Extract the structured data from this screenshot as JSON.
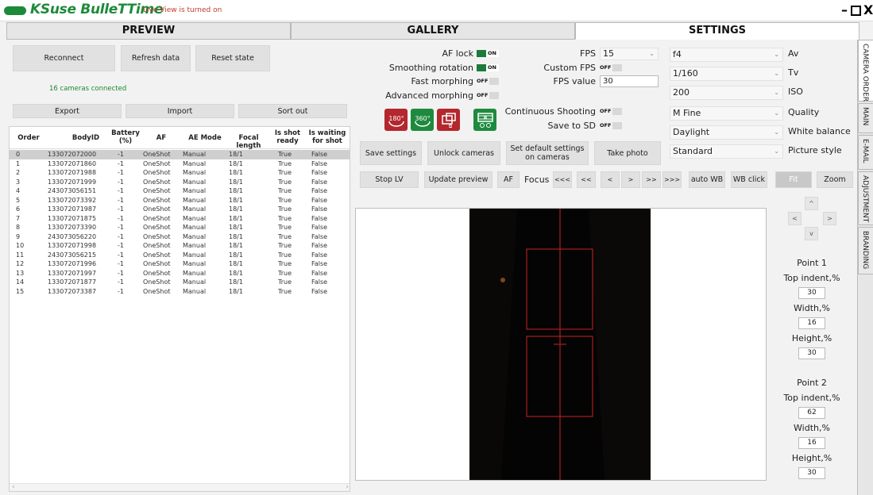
{
  "app": {
    "title": "KSuse BulleTTime",
    "live_view_status": "Live View is turned on"
  },
  "main_tabs": [
    {
      "label": "PREVIEW"
    },
    {
      "label": "GALLERY"
    },
    {
      "label": "SETTINGS"
    }
  ],
  "left_panel": {
    "reconnect": "Reconnect",
    "refresh": "Refresh data",
    "reset": "Reset state",
    "connected": "16 cameras connected",
    "export": "Export",
    "import": "Import",
    "sort": "Sort out"
  },
  "table": {
    "columns": [
      "Order",
      "BodyID",
      "Battery (%)",
      "AF",
      "AE Mode",
      "Focal length",
      "Is shot ready",
      "Is waiting for shot"
    ],
    "rows": [
      [
        "0",
        "133072072000",
        "-1",
        "OneShot",
        "Manual",
        "18/1",
        "True",
        "False"
      ],
      [
        "1",
        "133072071860",
        "-1",
        "OneShot",
        "Manual",
        "18/1",
        "True",
        "False"
      ],
      [
        "2",
        "133072071988",
        "-1",
        "OneShot",
        "Manual",
        "18/1",
        "True",
        "False"
      ],
      [
        "3",
        "133072071999",
        "-1",
        "OneShot",
        "Manual",
        "18/1",
        "True",
        "False"
      ],
      [
        "4",
        "243073056151",
        "-1",
        "OneShot",
        "Manual",
        "18/1",
        "True",
        "False"
      ],
      [
        "5",
        "133072073392",
        "-1",
        "OneShot",
        "Manual",
        "18/1",
        "True",
        "False"
      ],
      [
        "6",
        "133072071987",
        "-1",
        "OneShot",
        "Manual",
        "18/1",
        "True",
        "False"
      ],
      [
        "7",
        "133072071875",
        "-1",
        "OneShot",
        "Manual",
        "18/1",
        "True",
        "False"
      ],
      [
        "8",
        "133072073390",
        "-1",
        "OneShot",
        "Manual",
        "18/1",
        "True",
        "False"
      ],
      [
        "9",
        "243073056220",
        "-1",
        "OneShot",
        "Manual",
        "18/1",
        "True",
        "False"
      ],
      [
        "10",
        "133072071998",
        "-1",
        "OneShot",
        "Manual",
        "18/1",
        "True",
        "False"
      ],
      [
        "11",
        "243073056215",
        "-1",
        "OneShot",
        "Manual",
        "18/1",
        "True",
        "False"
      ],
      [
        "12",
        "133072071996",
        "-1",
        "OneShot",
        "Manual",
        "18/1",
        "True",
        "False"
      ],
      [
        "13",
        "133072071997",
        "-1",
        "OneShot",
        "Manual",
        "18/1",
        "True",
        "False"
      ],
      [
        "14",
        "133072071877",
        "-1",
        "OneShot",
        "Manual",
        "18/1",
        "True",
        "False"
      ],
      [
        "15",
        "133072073387",
        "-1",
        "OneShot",
        "Manual",
        "18/1",
        "True",
        "False"
      ]
    ]
  },
  "toggles": {
    "af_lock": {
      "label": "AF lock",
      "state": "ON"
    },
    "smoothing": {
      "label": "Smoothing rotation",
      "state": "ON"
    },
    "fast_morph": {
      "label": "Fast morphing",
      "state": "OFF"
    },
    "adv_morph": {
      "label": "Advanced morphing",
      "state": "OFF"
    },
    "custom_fps": {
      "label": "Custom FPS",
      "state": "OFF"
    },
    "continuous": {
      "label": "Continuous Shooting",
      "state": "OFF"
    },
    "save_sd": {
      "label": "Save to SD",
      "state": "OFF"
    }
  },
  "fps": {
    "label": "FPS",
    "value": "15",
    "value_label": "FPS value",
    "custom_value": "30"
  },
  "mode_icons": [
    {
      "glyph": "180°",
      "color": "#b3272d"
    },
    {
      "glyph": "360°",
      "color": "#1e8a3e"
    },
    {
      "glyph": "⧉",
      "color": "#b3272d"
    },
    {
      "glyph": "▦",
      "color": "#1e8a3e"
    }
  ],
  "camera_settings": [
    {
      "value": "f4",
      "label": "Av"
    },
    {
      "value": "1/160",
      "label": "Tv"
    },
    {
      "value": "200",
      "label": "ISO"
    },
    {
      "value": "M Fine",
      "label": "Quality"
    },
    {
      "value": "Daylight",
      "label": "White balance"
    },
    {
      "value": "Standard",
      "label": "Picture style"
    }
  ],
  "action_buttons": {
    "save": "Save settings",
    "unlock": "Unlock cameras",
    "set_default": "Set default settings on cameras",
    "take_photo": "Take photo"
  },
  "lv_toolbar": {
    "stop_lv": "Stop LV",
    "update_preview": "Update preview",
    "af": "AF",
    "focus": "Focus",
    "f_lll": "<<<",
    "f_ll": "<<",
    "f_l": "<",
    "f_r": ">",
    "f_rr": ">>",
    "f_rrr": ">>>",
    "auto_wb": "auto WB",
    "wb_click": "WB click",
    "fit": "Fit",
    "zoom": "Zoom"
  },
  "nav_arrows": {
    "up": "^",
    "left": "<",
    "right": ">",
    "down": "v"
  },
  "points": [
    {
      "title": "Point 1",
      "top_label": "Top indent,%",
      "top": "30",
      "width_label": "Width,%",
      "width": "16",
      "height_label": "Height,%",
      "height": "30"
    },
    {
      "title": "Point 2",
      "top_label": "Top indent,%",
      "top": "62",
      "width_label": "Width,%",
      "width": "16",
      "height_label": "Height,%",
      "height": "30"
    }
  ],
  "side_tabs": [
    {
      "label": "CAMERA ORDER"
    },
    {
      "label": "MAIN"
    },
    {
      "label": "E-MAIL"
    },
    {
      "label": "ADJUSTMENT"
    },
    {
      "label": "BRANDING"
    }
  ],
  "colors": {
    "brand_green": "#1e8a3a",
    "status_red": "#c0392b",
    "guide_red": "#d02020"
  }
}
